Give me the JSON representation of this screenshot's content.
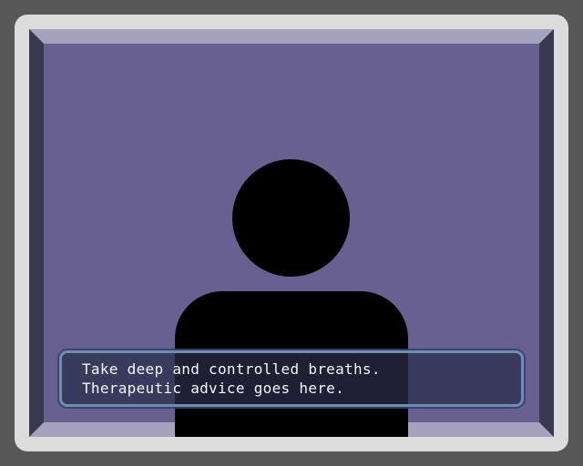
{
  "scene": {
    "frame_color": "#575757",
    "bezel_color": "#dcdcdc",
    "background_color": "#676091",
    "bevel_top_color": "#a4a2bd",
    "bevel_side_color": "#3a384f",
    "silhouette_color": "#000000"
  },
  "dialog": {
    "lines": [
      "Take deep and controlled breaths.",
      "Therapeutic advice goes here."
    ],
    "text_color": "#f4f4f8",
    "border_color": "#6f8db0"
  }
}
